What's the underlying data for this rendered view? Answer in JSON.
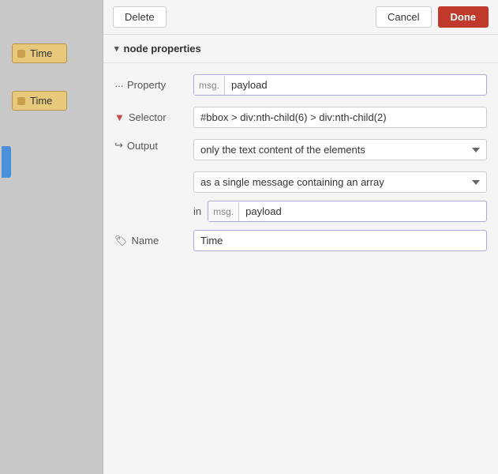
{
  "canvas": {
    "nodes": [
      {
        "label": "Time"
      },
      {
        "label": "Time"
      }
    ]
  },
  "toolbar": {
    "delete_label": "Delete",
    "cancel_label": "Cancel",
    "done_label": "Done"
  },
  "section": {
    "title": "node properties",
    "chevron": "▾"
  },
  "properties": {
    "property": {
      "label": "Property",
      "prefix": "msg.",
      "value": "payload"
    },
    "selector": {
      "label": "Selector",
      "value": "#bbox > div:nth-child(6) > div:nth-child(2)"
    },
    "output": {
      "label": "Output",
      "option1": "only the text content of the elements",
      "option2": "as a single message containing an array",
      "in_label": "in",
      "msg_prefix": "msg.",
      "payload_value": "payload"
    },
    "name": {
      "label": "Name",
      "value": "Time"
    }
  },
  "icons": {
    "dots": "···",
    "filter": "▼",
    "output_arrow": "↪",
    "tag": "🏷"
  }
}
